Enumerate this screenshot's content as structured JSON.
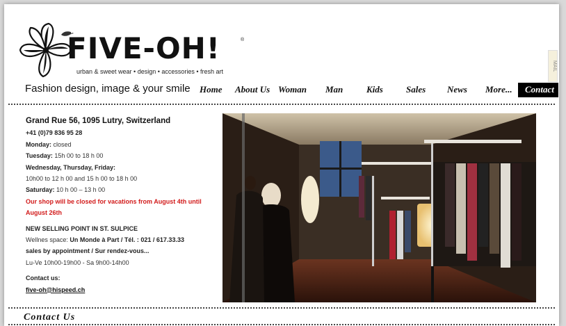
{
  "brand": {
    "logo_text": "FIVE-OH!",
    "tagline_small": "urban & sweet wear • design • accessories • fresh art",
    "slogan": "Fashion design, image & your smile"
  },
  "nav": {
    "items": [
      "Home",
      "About Us",
      "Woman",
      "Man",
      "Kids",
      "Sales",
      "News",
      "More...",
      "Contact"
    ]
  },
  "side_tab": "MAIL",
  "info": {
    "address": "Grand Rue 56, 1095 Lutry, Switzerland",
    "phone": "+41 (0)79 836 95 28",
    "monday_label": "Monday:",
    "monday_value": "closed",
    "tuesday_label": "Tuesday:",
    "tuesday_value": "15h 00 to 18 h 00",
    "wed_fri_label": "Wednesday, Thursday, Friday:",
    "wed_fri_value": "10h00 to 12 h 00 and 15 h 00 to 18 h 00",
    "saturday_label": "Saturday:",
    "saturday_value": "10 h 00 – 13 h 00",
    "vacation_notice": "Our shop will be closed for vacations from August 4th until August 26th",
    "selling_point_title": "NEW SELLING POINT IN ST. SULPICE",
    "wellnes_prefix": "Wellnes space:",
    "wellnes_value": "Un Monde à Part / Tél. : 021 / 617.33.33",
    "appointment": "sales by appointment / Sur rendez-vous...",
    "hours_line": "Lu-Ve 10h00-19h00 - Sa 9h00-14h00",
    "contact_label": "Contact us:",
    "email": "five-oh@hispeed.ch"
  },
  "footer": {
    "contact_heading": "Contact Us"
  }
}
